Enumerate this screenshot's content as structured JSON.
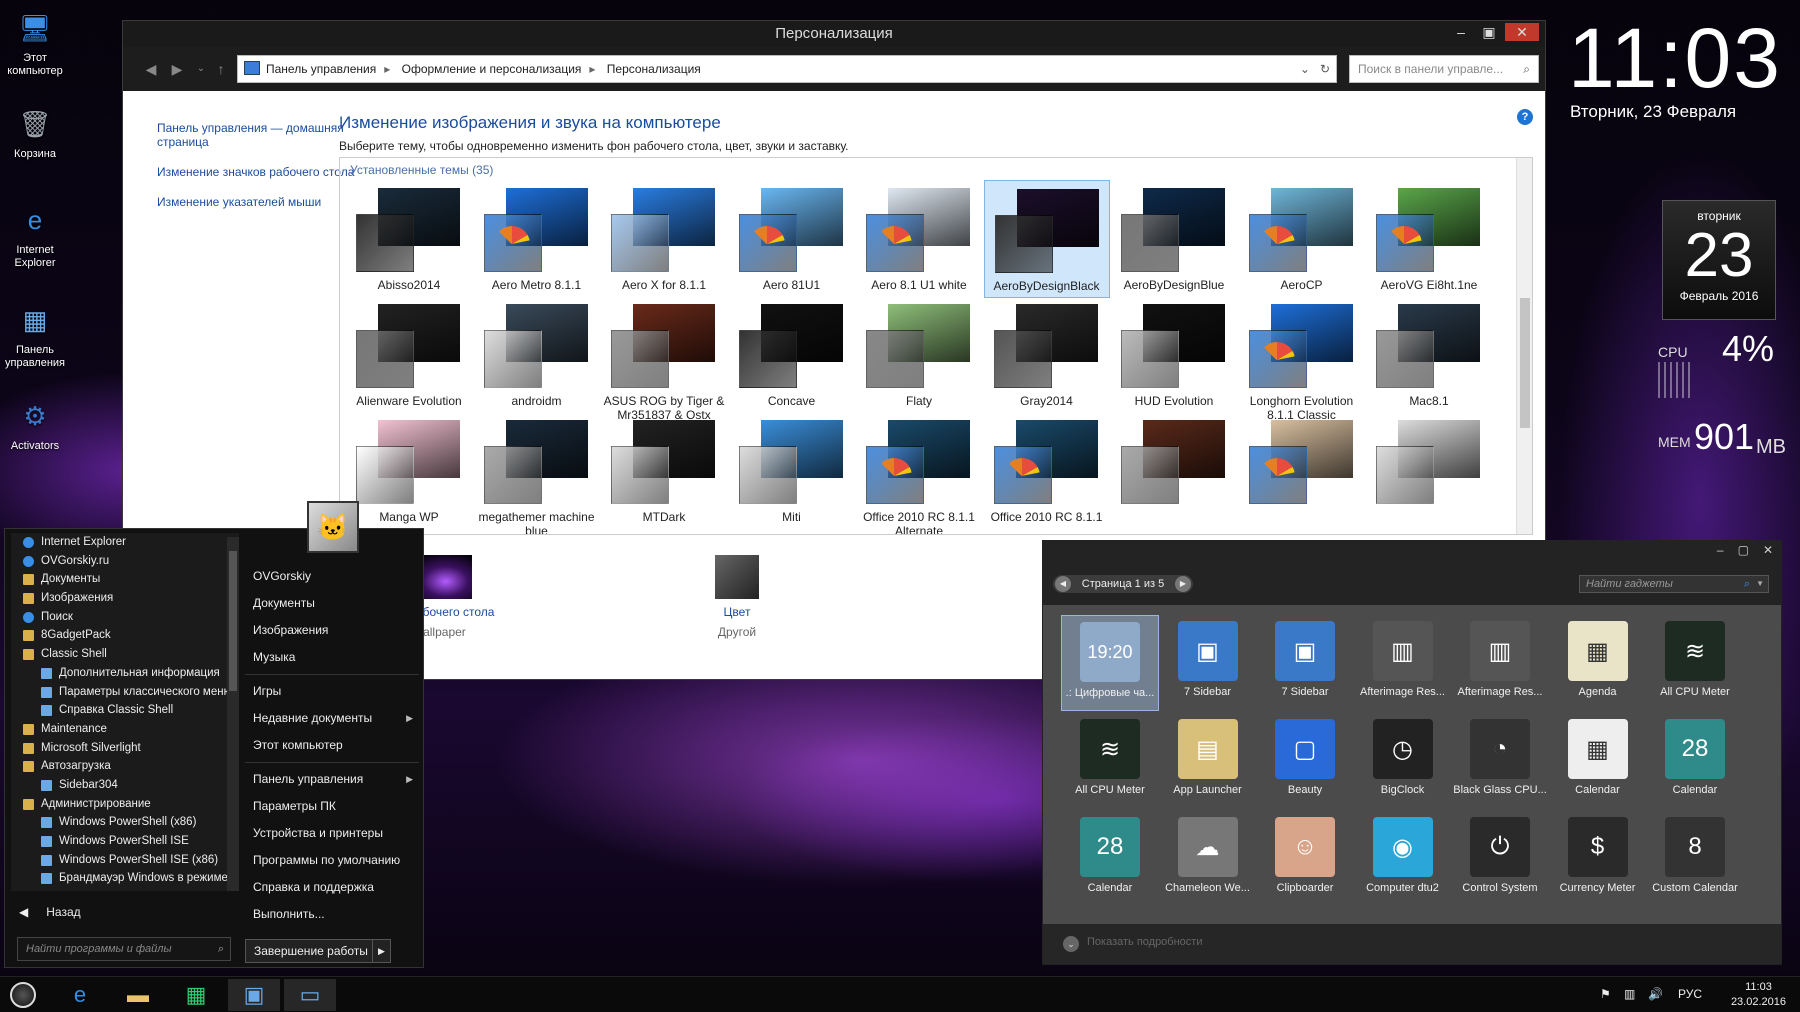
{
  "desktop": {
    "icons": [
      {
        "label": "Этот компьютер",
        "icon": "computer-icon"
      },
      {
        "label": "Корзина",
        "icon": "recycle-bin-icon"
      },
      {
        "label": "Internet Explorer",
        "icon": "ie-icon"
      },
      {
        "label": "Панель управления",
        "icon": "control-panel-icon"
      },
      {
        "label": "Activators",
        "icon": "activators-icon"
      }
    ]
  },
  "clock": {
    "time": "11:03",
    "date": "Вторник, 23 Февраля"
  },
  "calendar_gadget": {
    "day_name": "вторник",
    "day": "23",
    "month_year": "Февраль 2016"
  },
  "cpu": {
    "label": "CPU",
    "value": "4%",
    "level_percent": 4
  },
  "mem": {
    "label": "MEM",
    "value": "901",
    "unit": "MB"
  },
  "personalization": {
    "title": "Персонализация",
    "breadcrumbs": [
      "Панель управления",
      "Оформление и персонализация",
      "Персонализация"
    ],
    "search_placeholder": "Поиск в панели управле...",
    "left_nav": [
      "Панель управления — домашняя страница",
      "Изменение значков рабочего стола",
      "Изменение указателей мыши"
    ],
    "heading": "Изменение изображения и звука на компьютере",
    "description": "Выберите тему, чтобы одновременно изменить фон рабочего стола, цвет, звуки и заставку.",
    "themes_header": "Установленные темы (35)",
    "themes_row1": [
      "Abisso2014",
      "Aero Metro 8.1.1",
      "Aero X for 8.1.1",
      "Aero 81U1",
      "Aero 8.1 U1 white",
      "AeroByDesignBlack",
      "AeroByDesignBlue",
      "AeroCP",
      "AeroVG Ei8ht.1ne"
    ],
    "themes_row2": [
      "Alienware Evolution",
      "androidm",
      "ASUS ROG by Tiger & Mr351837 & Ostx",
      "Concave",
      "Flaty",
      "Gray2014",
      "HUD Evolution",
      "Longhorn Evolution 8.1.1 Classic",
      "Mac8.1"
    ],
    "themes_row3": [
      "Manga WP",
      "megathemer machine blue",
      "MTDark",
      "Miti",
      "Office 2010 RC 8.1.1 Alternate",
      "Office 2010 RC 8.1.1",
      "",
      "",
      ""
    ],
    "selected_theme": "AeroByDesignBlack",
    "wallpaper_link": "Фон рабочего стола",
    "wallpaper_value": "Wallpaper",
    "color_link": "Цвет",
    "color_value": "Другой"
  },
  "start_menu": {
    "programs": [
      {
        "label": "Internet Explorer",
        "level": 1,
        "icon": "ie-icon"
      },
      {
        "label": "OVGorskiy.ru",
        "level": 1,
        "icon": "ie-icon"
      },
      {
        "label": "Документы",
        "level": 1,
        "icon": "folder-icon"
      },
      {
        "label": "Изображения",
        "level": 1,
        "icon": "folder-icon"
      },
      {
        "label": "Поиск",
        "level": 1,
        "icon": "search-icon"
      },
      {
        "label": "8GadgetPack",
        "level": 1,
        "icon": "folder-icon"
      },
      {
        "label": "Classic Shell",
        "level": 1,
        "icon": "folder-icon"
      },
      {
        "label": "Дополнительная информация",
        "level": 2,
        "icon": "doc-icon"
      },
      {
        "label": "Параметры классического меню",
        "level": 2,
        "icon": "settings-icon"
      },
      {
        "label": "Справка Classic Shell",
        "level": 2,
        "icon": "help-icon"
      },
      {
        "label": "Maintenance",
        "level": 1,
        "icon": "folder-icon"
      },
      {
        "label": "Microsoft Silverlight",
        "level": 1,
        "icon": "folder-icon"
      },
      {
        "label": "Автозагрузка",
        "level": 1,
        "icon": "folder-icon"
      },
      {
        "label": "Sidebar304",
        "level": 2,
        "icon": "app-icon"
      },
      {
        "label": "Администрирование",
        "level": 1,
        "icon": "folder-icon"
      },
      {
        "label": "Windows PowerShell (x86)",
        "level": 2,
        "icon": "powershell-icon"
      },
      {
        "label": "Windows PowerShell ISE",
        "level": 2,
        "icon": "powershell-icon"
      },
      {
        "label": "Windows PowerShell ISE (x86)",
        "level": 2,
        "icon": "powershell-icon"
      },
      {
        "label": "Брандмауэр Windows в режиме",
        "level": 2,
        "icon": "firewall-icon"
      }
    ],
    "back_label": "Назад",
    "search_placeholder": "Найти программы и файлы",
    "right_items": [
      {
        "label": "OVGorskiy",
        "arrow": false
      },
      {
        "label": "Документы",
        "arrow": false
      },
      {
        "label": "Изображения",
        "arrow": false
      },
      {
        "label": "Музыка",
        "arrow": false,
        "sep_after": true
      },
      {
        "label": "Игры",
        "arrow": false
      },
      {
        "label": "Недавние документы",
        "arrow": true
      },
      {
        "label": "Этот компьютер",
        "arrow": false,
        "sep_after": true
      },
      {
        "label": "Панель управления",
        "arrow": true
      },
      {
        "label": "Параметры ПК",
        "arrow": false
      },
      {
        "label": "Устройства и принтеры",
        "arrow": false
      },
      {
        "label": "Программы по умолчанию",
        "arrow": false
      },
      {
        "label": "Справка и поддержка",
        "arrow": false
      },
      {
        "label": "Выполнить...",
        "arrow": false
      }
    ],
    "shutdown_label": "Завершение работы"
  },
  "gadgets": {
    "page": "Страница 1 из 5",
    "search_placeholder": "Найти гаджеты",
    "items": [
      {
        "label": ".: Цифровые ча...",
        "color": "#8fa9c9",
        "glyph": "19:20",
        "selected": true
      },
      {
        "label": "7 Sidebar",
        "color": "#3a78c8",
        "glyph": "▣"
      },
      {
        "label": "7 Sidebar",
        "color": "#3a78c8",
        "glyph": "▣"
      },
      {
        "label": "Afterimage Res...",
        "color": "#555555",
        "glyph": "▥"
      },
      {
        "label": "Afterimage Res...",
        "color": "#555555",
        "glyph": "▥"
      },
      {
        "label": "Agenda",
        "color": "#e9e4c8",
        "glyph": "▦"
      },
      {
        "label": "All CPU Meter",
        "color": "#1d2b22",
        "glyph": "≋"
      },
      {
        "label": "All CPU Meter",
        "color": "#1d2b22",
        "glyph": "≋"
      },
      {
        "label": "App Launcher",
        "color": "#d9c07a",
        "glyph": "▤"
      },
      {
        "label": "Beauty",
        "color": "#2a6ad8",
        "glyph": "▢"
      },
      {
        "label": "BigClock",
        "color": "#222222",
        "glyph": "◷"
      },
      {
        "label": "Black Glass CPU...",
        "color": "#333333",
        "glyph": "◔"
      },
      {
        "label": "Calendar",
        "color": "#eeeeee",
        "glyph": "▦"
      },
      {
        "label": "Calendar",
        "color": "#2f8a8a",
        "glyph": "28"
      },
      {
        "label": "Calendar",
        "color": "#2f8a8a",
        "glyph": "28"
      },
      {
        "label": "Chameleon We...",
        "color": "#777777",
        "glyph": "☁"
      },
      {
        "label": "Clipboarder",
        "color": "#d9a58a",
        "glyph": "☺"
      },
      {
        "label": "Computer dtu2",
        "color": "#2aa6d8",
        "glyph": "◉"
      },
      {
        "label": "Control System",
        "color": "#2a2a2a",
        "glyph": "⏻"
      },
      {
        "label": "Currency Meter",
        "color": "#2a2a2a",
        "glyph": "$"
      },
      {
        "label": "Custom Calendar",
        "color": "#333333",
        "glyph": "8"
      }
    ],
    "footer": "Показать подробности"
  },
  "taskbar": {
    "lang": "РУС",
    "time": "11:03",
    "date": "23.02.2016"
  }
}
